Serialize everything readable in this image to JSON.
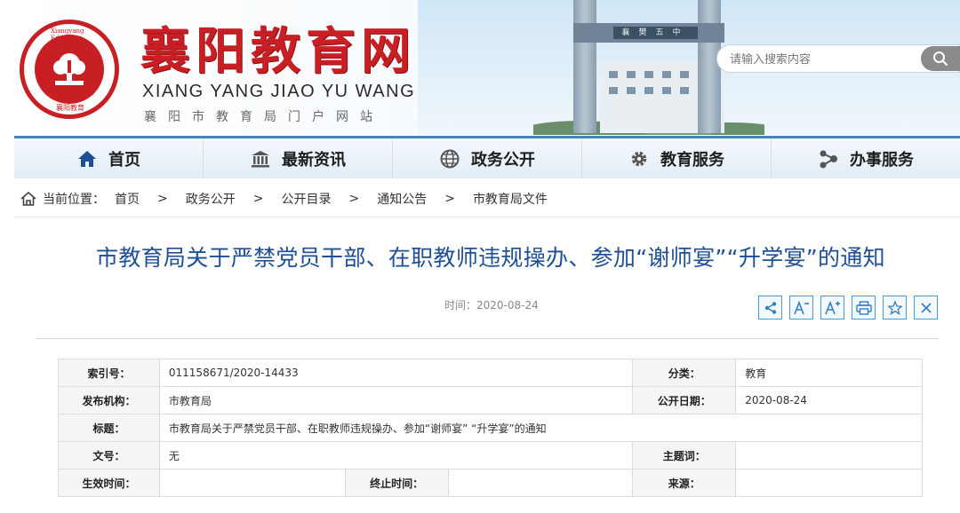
{
  "header": {
    "site_title": "襄阳教育网",
    "pinyin": "XIANG YANG JIAO YU WANG",
    "subtitle": "襄阳市教育局门户网站",
    "emblem_text": "Xiangyang Education",
    "emblem_cn": "襄阳教育",
    "gate_plaque": "襄樊五中"
  },
  "search": {
    "placeholder": "请输入搜索内容",
    "icon": "search-icon"
  },
  "nav": {
    "items": [
      {
        "label": "首页",
        "icon": "home-icon"
      },
      {
        "label": "最新资讯",
        "icon": "bank-icon"
      },
      {
        "label": "政务公开",
        "icon": "globe-icon"
      },
      {
        "label": "教育服务",
        "icon": "gear-icon"
      },
      {
        "label": "办事服务",
        "icon": "share-nodes-icon"
      }
    ],
    "accent": "#3c86c8"
  },
  "breadcrumb": {
    "label": "当前位置：",
    "items": [
      "首页",
      "政务公开",
      "公开目录",
      "通知公告",
      "市教育局文件"
    ],
    "separator": ">"
  },
  "article": {
    "title": "市教育局关于严禁党员干部、在职教师违规操办、参加“谢师宴”“升学宴”的通知",
    "time_label": "时间：",
    "time_value": "2020-08-24",
    "tools": [
      "share-icon",
      "font-decrease-icon",
      "font-increase-icon",
      "print-icon",
      "favorite-icon",
      "close-icon"
    ],
    "title_color": "#1f4f95"
  },
  "meta": {
    "index_label": "索引号：",
    "index_value": "011158671/2020-14433",
    "category_label": "分类：",
    "category_value": "教育",
    "publisher_label": "发布机构：",
    "publisher_value": "市教育局",
    "pubdate_label": "公开日期：",
    "pubdate_value": "2020-08-24",
    "title_label": "标题：",
    "title_value": "市教育局关于严禁党员干部、在职教师违规操办、参加“谢师宴” “升学宴”的通知",
    "docno_label": "文号：",
    "docno_value": "无",
    "keywords_label": "主题词：",
    "keywords_value": "",
    "effective_label": "生效时间：",
    "effective_value": "",
    "expire_label": "终止时间：",
    "expire_value": "",
    "source_label": "来源：",
    "source_value": ""
  },
  "colors": {
    "brand_red": "#c81f24",
    "link_blue": "#1f4f95",
    "nav_border": "#3c86c8"
  }
}
